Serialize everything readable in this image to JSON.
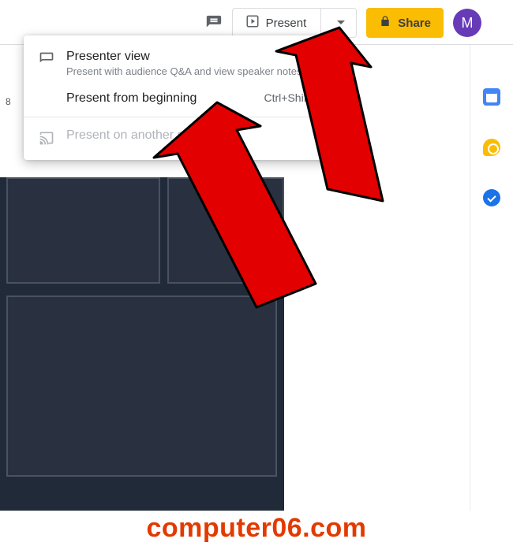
{
  "toolbar": {
    "present_label": "Present",
    "share_label": "Share",
    "avatar_initial": "M"
  },
  "collapse_caret_glyph": "⌃",
  "left_strip_number": "8",
  "menu": {
    "items": [
      {
        "title": "Presenter view",
        "subtitle": "Present with audience Q&A and view speaker notes",
        "shortcut": ""
      },
      {
        "title": "Present from beginning",
        "subtitle": "",
        "shortcut": "Ctrl+Shift+F5"
      },
      {
        "title": "Present on another screen...",
        "subtitle": "",
        "shortcut": ""
      }
    ]
  },
  "watermark": "computer06.com"
}
